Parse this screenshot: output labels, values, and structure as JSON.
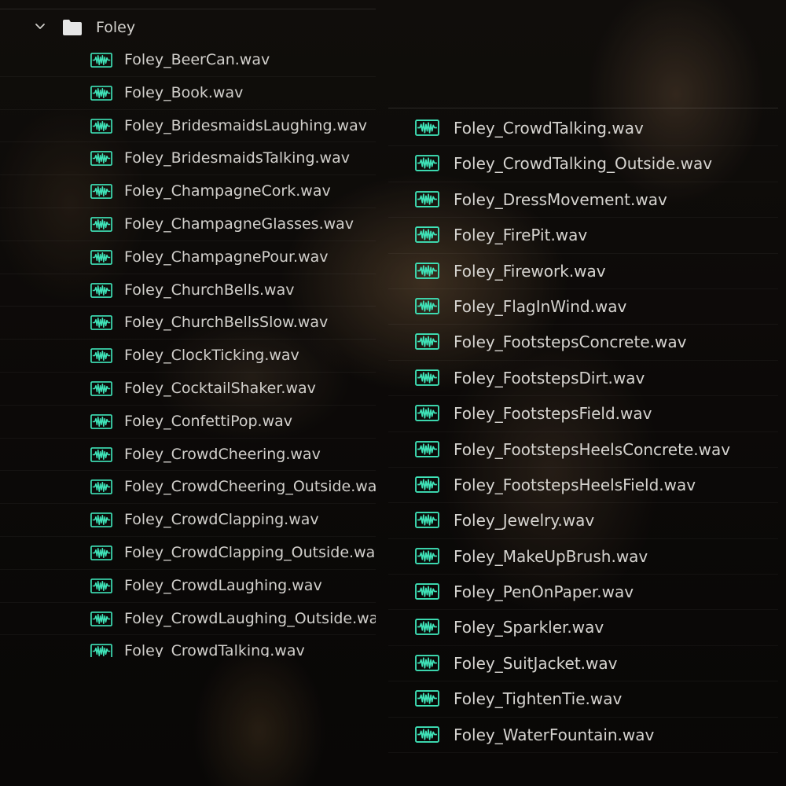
{
  "folder": {
    "name": "Foley",
    "icon": "folder-icon",
    "expander_icon": "chevron-down-icon"
  },
  "colors": {
    "audio_icon": "#3fe3b8",
    "text": "#d4d2ce",
    "folder_icon": "#e6e6e6"
  },
  "file_icon": "audio-waveform-icon",
  "left_panel": {
    "files": [
      "Foley_BeerCan.wav",
      "Foley_Book.wav",
      "Foley_BridesmaidsLaughing.wav",
      "Foley_BridesmaidsTalking.wav",
      "Foley_ChampagneCork.wav",
      "Foley_ChampagneGlasses.wav",
      "Foley_ChampagnePour.wav",
      "Foley_ChurchBells.wav",
      "Foley_ChurchBellsSlow.wav",
      "Foley_ClockTicking.wav",
      "Foley_CocktailShaker.wav",
      "Foley_ConfettiPop.wav",
      "Foley_CrowdCheering.wav",
      "Foley_CrowdCheering_Outside.wav",
      "Foley_CrowdClapping.wav",
      "Foley_CrowdClapping_Outside.wav",
      "Foley_CrowdLaughing.wav",
      "Foley_CrowdLaughing_Outside.wav",
      "Foley_CrowdTalking.wav"
    ]
  },
  "right_panel": {
    "files": [
      "Foley_CrowdTalking.wav",
      "Foley_CrowdTalking_Outside.wav",
      "Foley_DressMovement.wav",
      "Foley_FirePit.wav",
      "Foley_Firework.wav",
      "Foley_FlagInWind.wav",
      "Foley_FootstepsConcrete.wav",
      "Foley_FootstepsDirt.wav",
      "Foley_FootstepsField.wav",
      "Foley_FootstepsHeelsConcrete.wav",
      "Foley_FootstepsHeelsField.wav",
      "Foley_Jewelry.wav",
      "Foley_MakeUpBrush.wav",
      "Foley_PenOnPaper.wav",
      "Foley_Sparkler.wav",
      "Foley_SuitJacket.wav",
      "Foley_TightenTie.wav",
      "Foley_WaterFountain.wav"
    ]
  }
}
